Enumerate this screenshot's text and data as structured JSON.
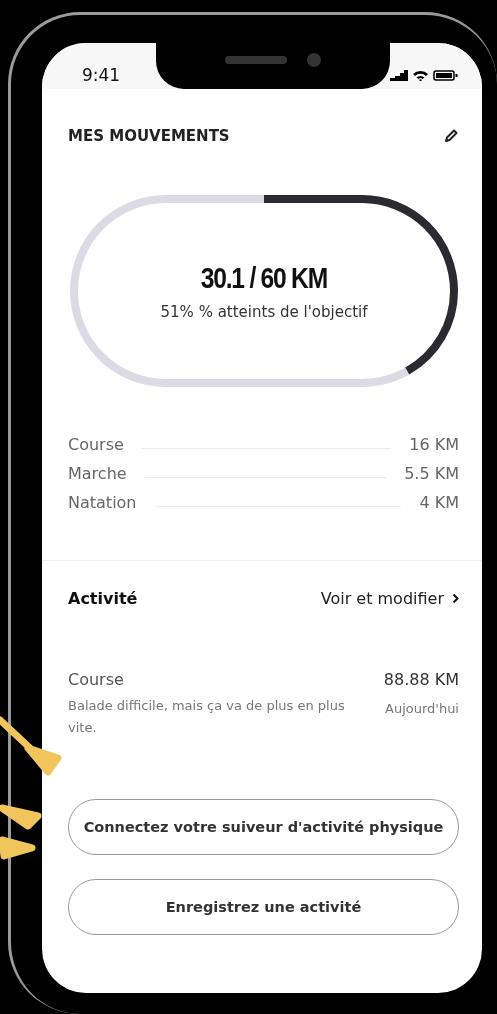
{
  "status_bar": {
    "time": "9:41"
  },
  "movements": {
    "title": "MES MOUVEMENTS",
    "goal": {
      "value": "30.1 / 60 KM",
      "caption": "51% % atteints de l'objectif"
    },
    "rows": [
      {
        "label": "Course",
        "value": "16 KM"
      },
      {
        "label": "Marche",
        "value": "5.5 KM"
      },
      {
        "label": "Natation",
        "value": "4 KM"
      }
    ]
  },
  "activity": {
    "title": "Activité",
    "link": "Voir et modifier",
    "entry": {
      "name": "Course",
      "distance": "88.88 KM",
      "note": "Balade difficile, mais ça va de plus en plus vite.",
      "date": "Aujourd'hui"
    }
  },
  "buttons": [
    "Connectez votre suiveur d'activité physique",
    "Enregistrez une activité"
  ]
}
